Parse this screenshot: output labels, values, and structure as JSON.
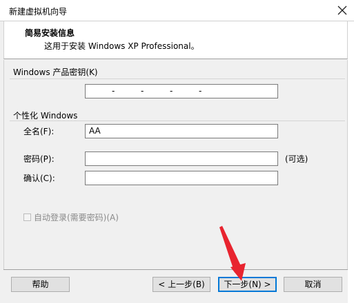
{
  "window": {
    "title": "新建虚拟机向导"
  },
  "header": {
    "title": "简易安装信息",
    "subtitle": "这用于安装 Windows XP Professional。"
  },
  "product_key": {
    "group_label": "Windows 产品密钥(K)",
    "value": "",
    "dashes": [
      "-",
      "-",
      "-",
      "-"
    ]
  },
  "personalize": {
    "group_label": "个性化 Windows",
    "fullname_label": "全名(F):",
    "fullname_value": "AA",
    "password_label": "密码(P):",
    "password_value": "",
    "optional_text": "(可选)",
    "confirm_label": "确认(C):",
    "confirm_value": ""
  },
  "autologin": {
    "label": "自动登录(需要密码)(A)",
    "checked": false,
    "disabled": true
  },
  "buttons": {
    "help": "帮助",
    "back": "< 上一步(B)",
    "next": "下一步(N) >",
    "cancel": "取消"
  },
  "colors": {
    "focus_border": "#0078d7",
    "annotation_arrow": "#e8242f"
  }
}
